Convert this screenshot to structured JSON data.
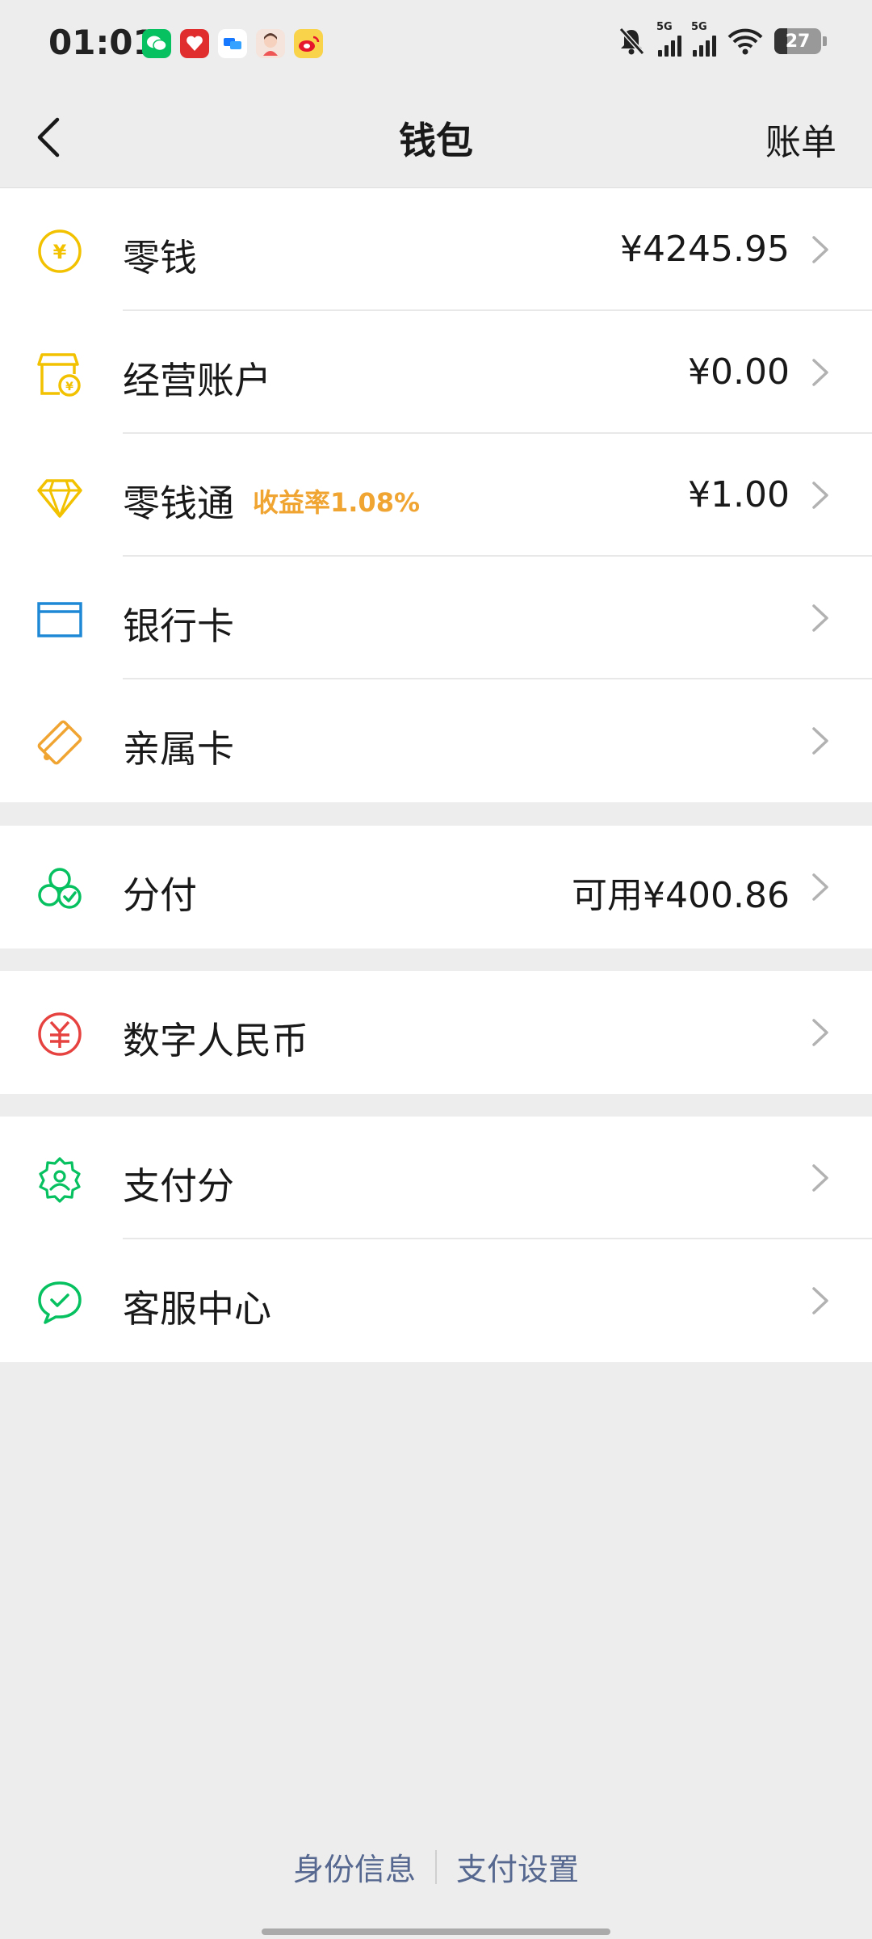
{
  "status_bar": {
    "time": "01:01",
    "network_1": "5G",
    "network_2": "5G",
    "battery": "27"
  },
  "nav": {
    "title": "钱包",
    "right_label": "账单"
  },
  "groups": [
    {
      "items": [
        {
          "label": "零钱",
          "value": "¥4245.95",
          "icon": "yuan-coin-icon",
          "color": "#f2c100"
        },
        {
          "label": "经营账户",
          "value": "¥0.00",
          "icon": "shop-account-icon",
          "color": "#f2c100"
        },
        {
          "label": "零钱通",
          "tag": "收益率1.08%",
          "value": "¥1.00",
          "icon": "diamond-icon",
          "color": "#f2c100"
        },
        {
          "label": "银行卡",
          "value": "",
          "icon": "bank-card-icon",
          "color": "#1e88d6"
        },
        {
          "label": "亲属卡",
          "value": "",
          "icon": "family-card-icon",
          "color": "#f0a432"
        }
      ]
    },
    {
      "items": [
        {
          "label": "分付",
          "value": "可用¥400.86",
          "icon": "fenfu-icon",
          "color": "#07c160"
        }
      ]
    },
    {
      "items": [
        {
          "label": "数字人民币",
          "value": "",
          "icon": "digital-rmb-icon",
          "color": "#e64340"
        }
      ]
    },
    {
      "items": [
        {
          "label": "支付分",
          "value": "",
          "icon": "pay-score-icon",
          "color": "#07c160"
        },
        {
          "label": "客服中心",
          "value": "",
          "icon": "customer-service-icon",
          "color": "#07c160"
        }
      ]
    }
  ],
  "footer": {
    "link_1": "身份信息",
    "link_2": "支付设置"
  },
  "colors": {
    "background": "#ededed",
    "accent_green": "#07c160",
    "tag_orange": "#f0a432",
    "footer_link": "#56688f"
  }
}
